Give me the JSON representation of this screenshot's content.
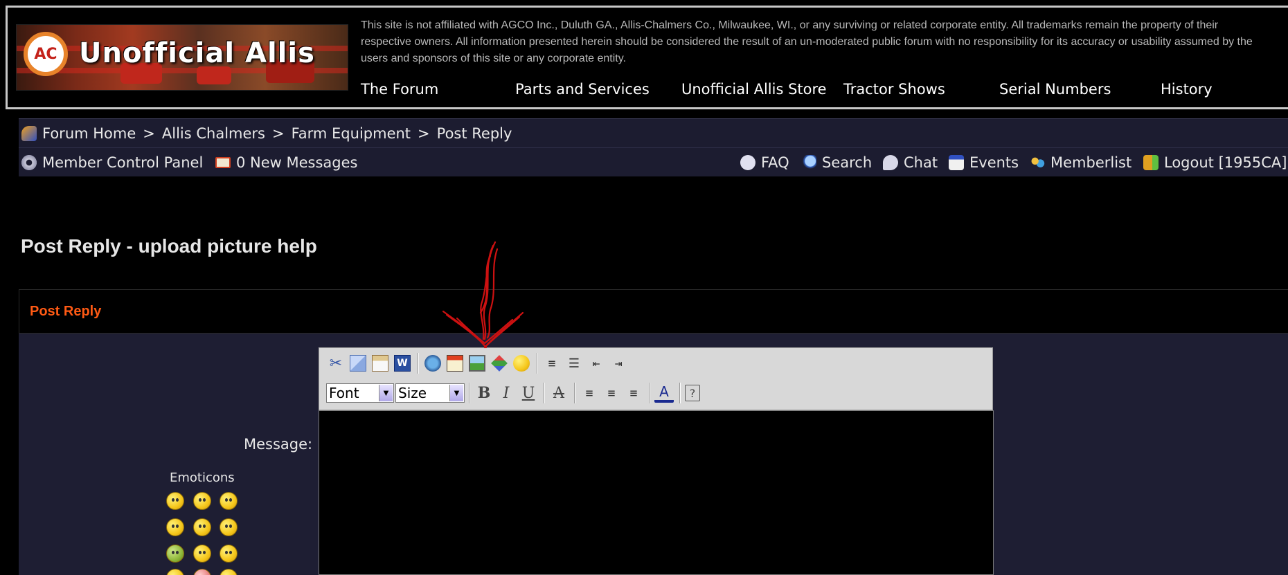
{
  "header": {
    "logo_text": "Unofficial Allis",
    "logo_badge": "AC",
    "disclaimer": "This site is not affiliated with AGCO Inc., Duluth GA., Allis-Chalmers Co., Milwaukee, WI., or any surviving or related corporate entity. All trademarks remain the property of their respective owners. All information presented herein should be considered the result of an un-moderated public forum with no responsibility for its accuracy or usability assumed by the users and sponsors of this site or any corporate entity.",
    "nav": [
      "The Forum",
      "Parts and Services",
      "Unofficial Allis Store",
      "Tractor Shows",
      "Serial Numbers",
      "History"
    ]
  },
  "breadcrumb": {
    "items": [
      "Forum Home",
      "Allis Chalmers",
      "Farm Equipment",
      "Post Reply"
    ],
    "separator": ">"
  },
  "member_bar": {
    "control_panel": "Member Control Panel",
    "messages": "0 New Messages",
    "faq": "FAQ",
    "search": "Search",
    "chat": "Chat",
    "events": "Events",
    "memberlist": "Memberlist",
    "logout": "Logout [1955CA]"
  },
  "page_title": "Post Reply - upload picture help",
  "panel": {
    "heading": "Post Reply",
    "message_label": "Message:",
    "emoticons_label": "Emoticons"
  },
  "editor": {
    "font_select": "Font",
    "size_select": "Size",
    "bold": "B",
    "italic": "I",
    "underline": "U",
    "help": "?",
    "text_color": "A"
  },
  "colors": {
    "accent": "#ff5a14",
    "bar_bg": "#1c1c30",
    "panel_bg": "#1e1e33",
    "annotation": "#cc1111"
  }
}
